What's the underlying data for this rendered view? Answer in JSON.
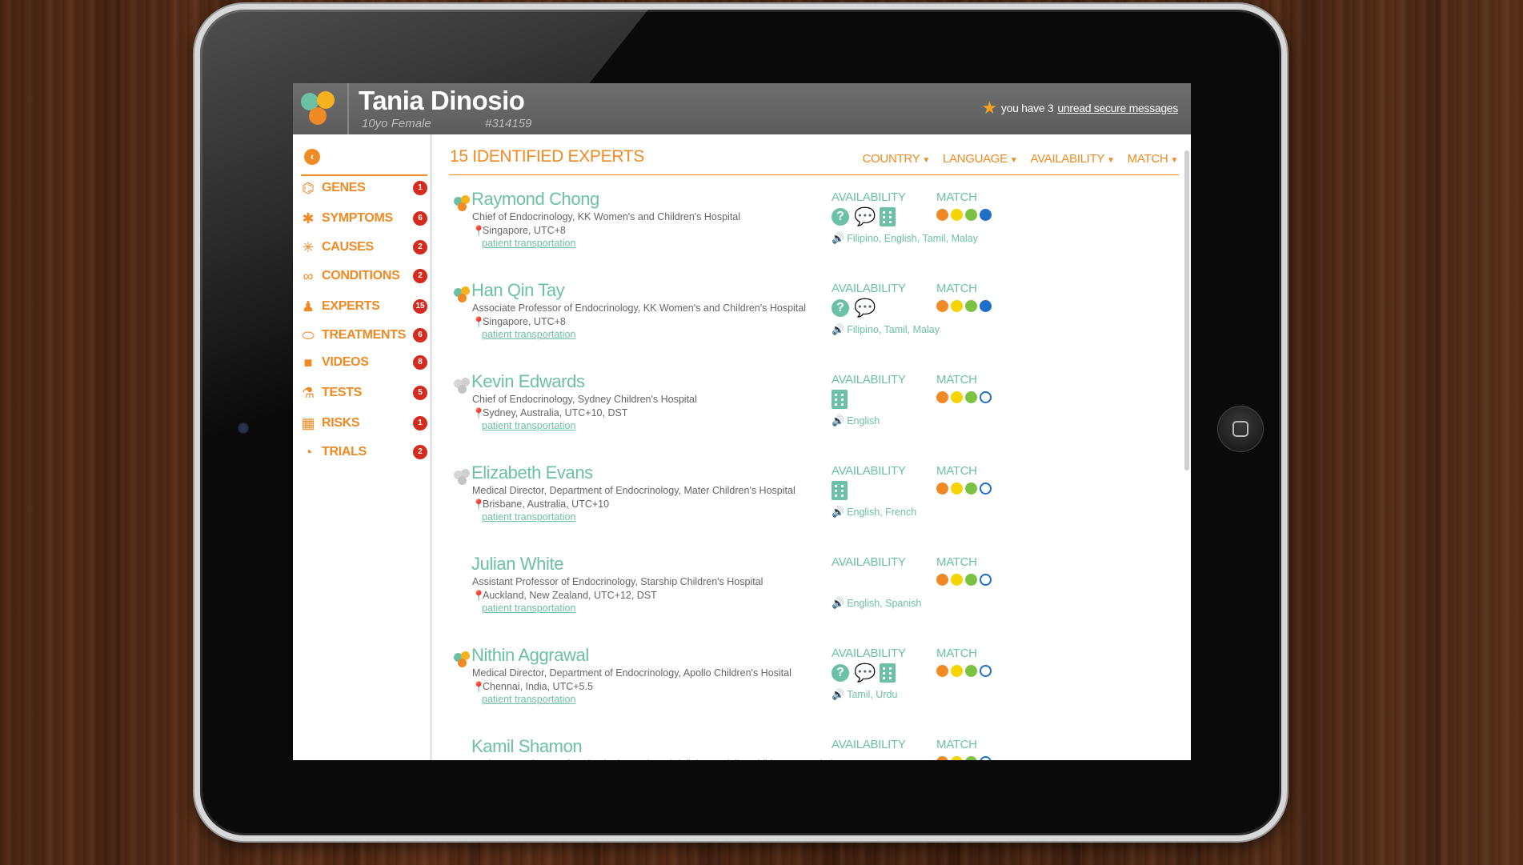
{
  "header": {
    "patient_name": "Tania Dinosio",
    "patient_age": "10yo Female",
    "patient_id": "#314159",
    "messages_prefix": "you have 3",
    "messages_link": "unread secure messages"
  },
  "sidebar": {
    "items": [
      {
        "label": "GENES",
        "badge": "1",
        "icon": "dna-icon",
        "glyph": "⌬"
      },
      {
        "label": "SYMPTOMS",
        "badge": "6",
        "icon": "person-icon",
        "glyph": "✱"
      },
      {
        "label": "CAUSES",
        "badge": "2",
        "icon": "burst-icon",
        "glyph": "✳"
      },
      {
        "label": "CONDITIONS",
        "badge": "2",
        "icon": "link-icon",
        "glyph": "∞"
      },
      {
        "label": "EXPERTS",
        "badge": "15",
        "icon": "user-icon",
        "glyph": "♟"
      },
      {
        "label": "TREATMENTS",
        "badge": "6",
        "icon": "pill-icon",
        "glyph": "⬭"
      },
      {
        "label": "VIDEOS",
        "badge": "8",
        "icon": "video-icon",
        "glyph": "■"
      },
      {
        "label": "TESTS",
        "badge": "5",
        "icon": "flask-icon",
        "glyph": "⚗"
      },
      {
        "label": "RISKS",
        "badge": "1",
        "icon": "chart-icon",
        "glyph": "▦"
      },
      {
        "label": "TRIALS",
        "badge": "2",
        "icon": "pie-icon",
        "glyph": "◔"
      }
    ]
  },
  "main": {
    "title": "15 IDENTIFIED EXPERTS",
    "filters": [
      "COUNTRY",
      "LANGUAGE",
      "AVAILABILITY",
      "MATCH"
    ],
    "availability_label": "AVAILABILITY",
    "match_label": "MATCH",
    "transport_label": "patient transportation"
  },
  "experts": [
    {
      "name": "Raymond Chong",
      "title": "Chief of Endocrinology, KK Women's and Children's Hospital",
      "location": "Singapore, UTC+8",
      "languages": "Filipino, English, Tamil, Malay",
      "logo": "color",
      "avail": [
        "question",
        "chat",
        "hospital"
      ],
      "match": 4,
      "show_transport": true
    },
    {
      "name": "Han Qin Tay",
      "title": "Associate Professor of Endocrinology, KK Women's and Children's Hospital",
      "location": "Singapore, UTC+8",
      "languages": "Filipino, Tamil, Malay",
      "logo": "color",
      "avail": [
        "question",
        "chat"
      ],
      "match": 4,
      "show_transport": true
    },
    {
      "name": "Kevin Edwards",
      "title": "Chief of Endocrinology, Sydney Children's Hospital",
      "location": "Sydney, Australia, UTC+10, DST",
      "languages": "English",
      "logo": "gray",
      "avail": [
        "hospital"
      ],
      "match": 3,
      "show_transport": true
    },
    {
      "name": "Elizabeth Evans",
      "title": "Medical Director, Department of Endocrinology, Mater Children's Hospital",
      "location": "Brisbane, Australia, UTC+10",
      "languages": "English, French",
      "logo": "gray",
      "avail": [
        "hospital"
      ],
      "match": 3,
      "show_transport": true
    },
    {
      "name": "Julian White",
      "title": "Assistant Professor of Endocrinology, Starship Children's Hospital",
      "location": "Auckland, New Zealand, UTC+12, DST",
      "languages": "English, Spanish",
      "logo": "none",
      "avail": [],
      "match": 3,
      "show_transport": true
    },
    {
      "name": "Nithin Aggrawal",
      "title": "Medical Director, Department of Endocrinology, Apollo Children's Hosital",
      "location": "Chennai, India, UTC+5.5",
      "languages": "Tamil, Urdu",
      "logo": "color",
      "avail": [
        "question",
        "chat",
        "hospital"
      ],
      "match": 3,
      "show_transport": true
    },
    {
      "name": "Kamil Shamon",
      "title": "Assistant Professor of Endocrinology, King Abdullah Specialist Children's Hospital",
      "location": "",
      "languages": "",
      "logo": "none",
      "avail": [],
      "match": 3,
      "show_transport": false
    }
  ],
  "colors": {
    "accent": "#f08a24",
    "teal": "#6cc0a5",
    "badge": "#d32b1f",
    "match": [
      "#f08a24",
      "#f5d400",
      "#7cc242",
      "#1f6fc8"
    ]
  }
}
